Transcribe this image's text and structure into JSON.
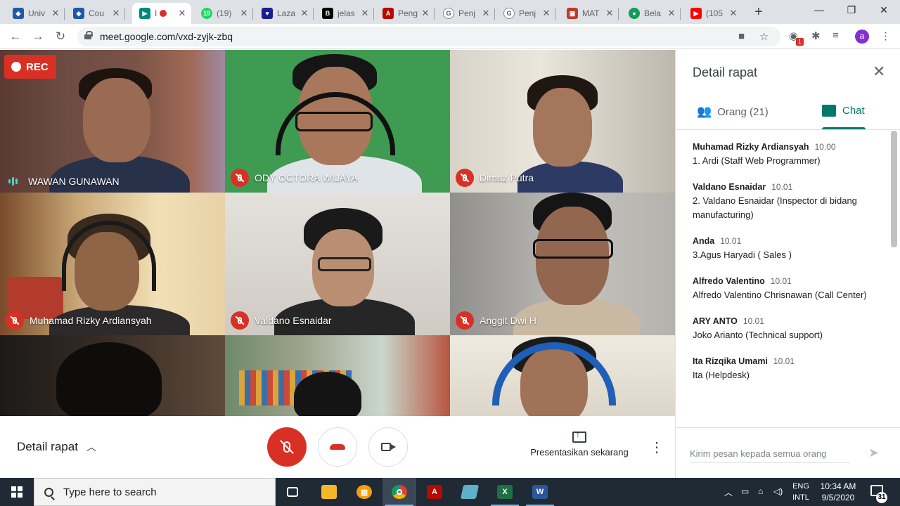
{
  "browser": {
    "tabs": [
      {
        "label": "Univ",
        "icon": "cloud-icon",
        "color": "#1e5aa8"
      },
      {
        "label": "Cou",
        "icon": "cloud-icon",
        "color": "#1e5aa8"
      },
      {
        "label": "",
        "icon": "meet-icon",
        "color": "#00897b"
      },
      {
        "label": "(19)",
        "icon": "whatsapp-icon",
        "color": "#25d366"
      },
      {
        "label": "Laza",
        "icon": "lazada-icon",
        "color": "#1a1e8f"
      },
      {
        "label": "jelas",
        "icon": "brainly-icon",
        "color": "#000000"
      },
      {
        "label": "Peng",
        "icon": "pdf-icon",
        "color": "#b30b00"
      },
      {
        "label": "Penj",
        "icon": "google-icon",
        "color": "#ffffff"
      },
      {
        "label": "Penj",
        "icon": "google-icon",
        "color": "#ffffff"
      },
      {
        "label": "MAT",
        "icon": "slides-icon",
        "color": "#c0392b"
      },
      {
        "label": "Bela",
        "icon": "classroom-icon",
        "color": "#0f9d58"
      },
      {
        "label": "(105",
        "icon": "youtube-icon",
        "color": "#ff0000"
      }
    ],
    "url": "meet.google.com/vxd-zyjk-zbq",
    "profile_initial": "a",
    "ext_badge": "1"
  },
  "meet": {
    "rec_label": "REC",
    "participants": [
      {
        "name": "WAWAN GUNAWAN",
        "muted": false
      },
      {
        "name": "ODY OCTORA WIJAYA",
        "muted": true
      },
      {
        "name": "Dimaz Putra",
        "muted": true
      },
      {
        "name": "Muhamad Rizky Ardiansyah",
        "muted": true
      },
      {
        "name": "Valdano Esnaidar",
        "muted": true
      },
      {
        "name": "Anggit Dwi H",
        "muted": true
      }
    ],
    "bottom": {
      "details_label": "Detail rapat",
      "present_label": "Presentasikan sekarang"
    }
  },
  "panel": {
    "title": "Detail rapat",
    "people_tab": "Orang (21)",
    "chat_tab": "Chat",
    "messages": [
      {
        "sender": "Muhamad Rizky Ardiansyah",
        "time": "10.00",
        "text": "1. Ardi (Staff Web Programmer)"
      },
      {
        "sender": "Valdano Esnaidar",
        "time": "10.01",
        "text": "2. Valdano Esnaidar (Inspector di bidang manufacturing)"
      },
      {
        "sender": "Anda",
        "time": "10.01",
        "text": "3.Agus Haryadi ( Sales )"
      },
      {
        "sender": "Alfredo Valentino",
        "time": "10.01",
        "text": "Alfredo Valentino Chrisnawan (Call Center)"
      },
      {
        "sender": "ARY ANTO",
        "time": "10.01",
        "text": "Joko Arianto (Technical support)"
      },
      {
        "sender": "Ita Rizqika Umami",
        "time": "10.01",
        "text": "Ita (Helpdesk)"
      }
    ],
    "input_placeholder": "Kirim pesan kepada semua orang"
  },
  "taskbar": {
    "search_placeholder": "Type here to search",
    "lang_top": "ENG",
    "lang_bottom": "INTL",
    "time": "10:34 AM",
    "date": "9/5/2020",
    "notif_count": "31"
  }
}
